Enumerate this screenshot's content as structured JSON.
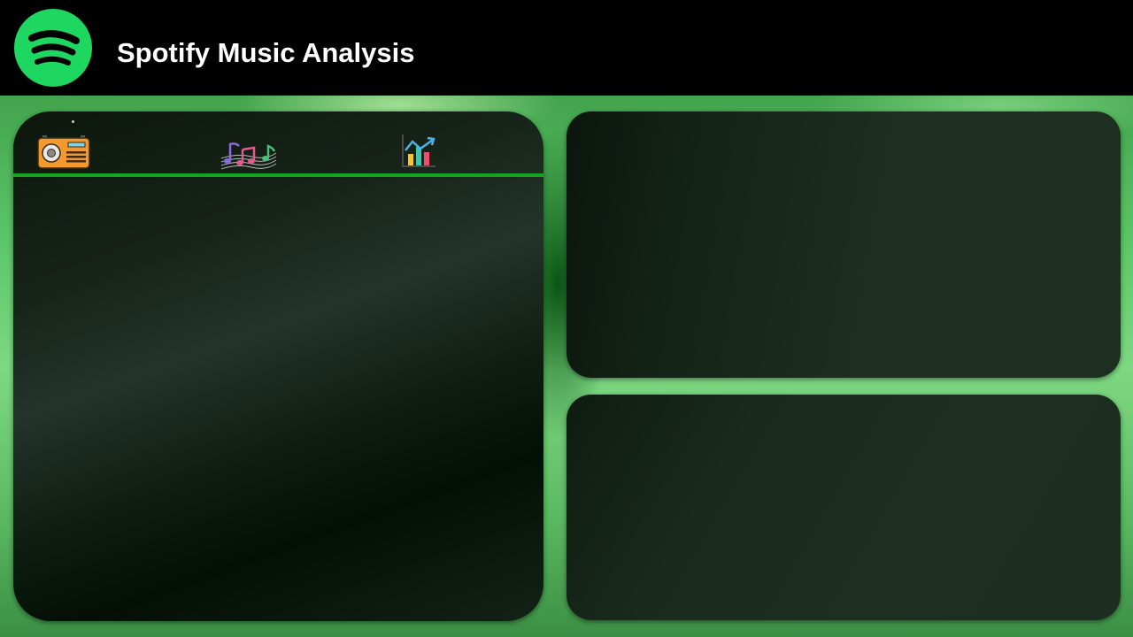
{
  "header": {
    "title": "Spotify Music Analysis",
    "logo_icon": "spotify-logo-icon"
  },
  "nav": {
    "items": [
      {
        "icon": "radio-icon"
      },
      {
        "icon": "music-notes-icon"
      },
      {
        "icon": "bar-chart-icon"
      }
    ],
    "divider_color": "#13a51f"
  },
  "colors": {
    "brand": "#1ed760",
    "header_bg": "#000000",
    "panel_bg": "#1c2f20"
  }
}
